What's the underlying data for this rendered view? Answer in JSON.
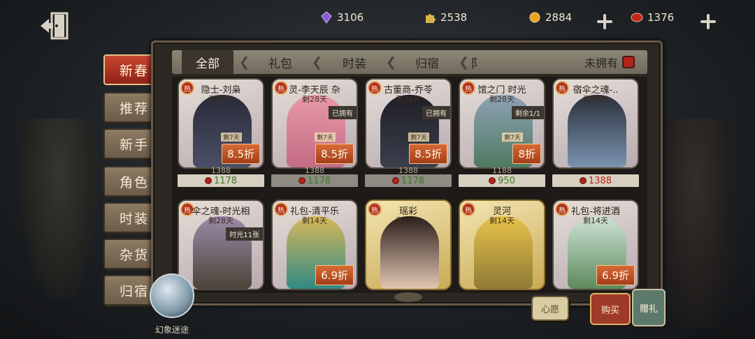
{
  "currencies": [
    {
      "icon": "purple-gem-icon",
      "value": "3106",
      "color": "#8a5ad6"
    },
    {
      "icon": "puzzle-piece-icon",
      "value": "2538",
      "color": "#d8b44a"
    },
    {
      "icon": "gold-coin-icon",
      "value": "2884",
      "color": "#e8a41f"
    },
    {
      "icon": "red-echo-icon",
      "value": "1376",
      "color": "#c0261a"
    }
  ],
  "side_tabs": [
    "新春",
    "推荐",
    "新手",
    "角色",
    "时装",
    "杂货",
    "归宿"
  ],
  "active_side_tab": "新春",
  "filters": [
    "全部",
    "礼包",
    "时装",
    "归宿",
    "阝"
  ],
  "active_filter": "全部",
  "owned_filter_label": "未拥有",
  "cards": [
    {
      "name": "隐士-刘枭",
      "remain": "剩28天",
      "hot": "热",
      "owned": "",
      "remain_small": "剩7天",
      "discount": "8.5折",
      "old_price": "1388",
      "price": "1178",
      "price_style": "light"
    },
    {
      "name": "灵-李天辰    杂",
      "remain": "剩28天",
      "hot": "热",
      "owned": "已拥有",
      "remain_small": "剩7天",
      "discount": "8.5折",
      "old_price": "1388",
      "price": "1178",
      "price_style": "dark"
    },
    {
      "name": "古董商-乔苓",
      "remain": "剩28天",
      "hot": "热",
      "owned": "已拥有",
      "remain_small": "剩7天",
      "discount": "8.5折",
      "old_price": "1388",
      "price": "1178",
      "price_style": "dark"
    },
    {
      "name": "馆之门    时光",
      "remain": "剩28天",
      "hot": "热",
      "owned": "剩余1/1",
      "remain_small": "剩7天",
      "discount": "8折",
      "old_price": "1188",
      "price": "950",
      "price_style": "light"
    },
    {
      "name": "宿伞之魂-..",
      "remain": "剩28天",
      "hot": "热",
      "owned": "",
      "remain_small": "",
      "discount": "",
      "old_price": "",
      "price": "1388",
      "price_style": "red"
    },
    {
      "name": "伞之魂-时光相",
      "remain": "剩28天",
      "hot": "热",
      "owned": "时光11张",
      "remain_small": "",
      "discount": "",
      "old_price": "",
      "price": "",
      "price_style": ""
    },
    {
      "name": "礼包-清平乐",
      "remain": "剩14天",
      "hot": "热",
      "owned": "",
      "remain_small": "",
      "discount": "6.9折",
      "old_price": "",
      "price": "",
      "price_style": ""
    },
    {
      "name": "瑶彩",
      "remain": "剩14天",
      "hot": "热",
      "owned": "",
      "remain_small": "",
      "discount": "",
      "old_price": "",
      "price": "",
      "price_style": ""
    },
    {
      "name": "灵河",
      "remain": "剩14天",
      "hot": "热",
      "owned": "",
      "remain_small": "",
      "discount": "",
      "old_price": "",
      "price": "",
      "price_style": ""
    },
    {
      "name": "礼包-将进酒",
      "remain": "剩14天",
      "hot": "热",
      "owned": "",
      "remain_small": "",
      "discount": "6.9折",
      "old_price": "",
      "price": "",
      "price_style": ""
    }
  ],
  "orb_label": "幻象迷途",
  "actions": {
    "wish": "心愿",
    "buy": "购买",
    "gift": "赠礼"
  }
}
